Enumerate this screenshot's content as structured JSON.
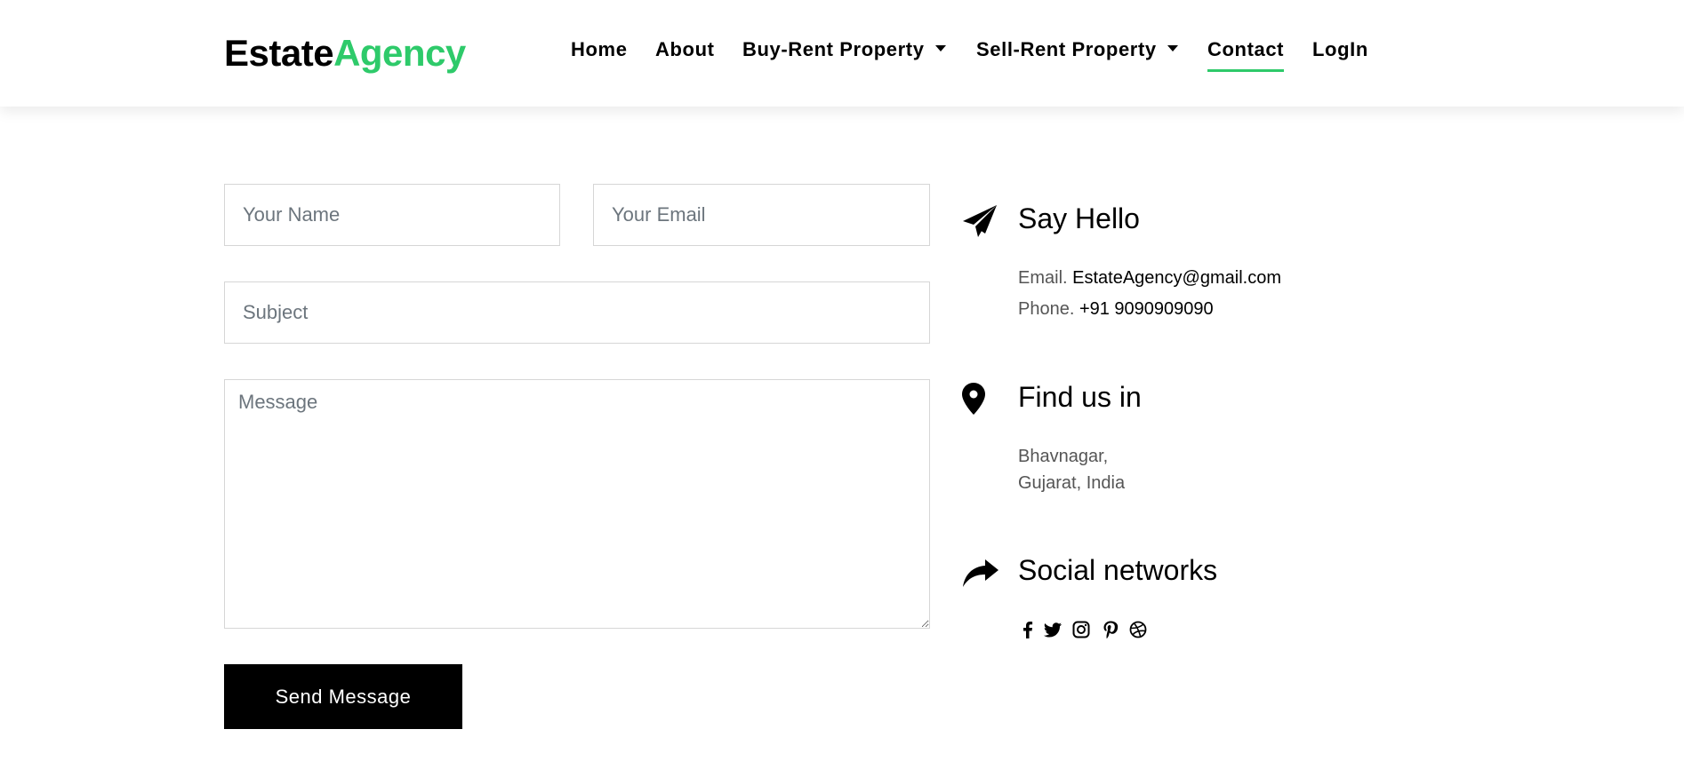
{
  "brand": {
    "part1": "Estate",
    "part2": "Agency"
  },
  "nav": {
    "home": "Home",
    "about": "About",
    "buy_rent": "Buy-Rent Property",
    "sell_rent": "Sell-Rent Property",
    "contact": "Contact",
    "login": "LogIn"
  },
  "form": {
    "name_placeholder": "Your Name",
    "email_placeholder": "Your Email",
    "subject_placeholder": "Subject",
    "message_placeholder": "Message",
    "send_label": "Send Message"
  },
  "say_hello": {
    "title": "Say Hello",
    "email_label": "Email.",
    "email_value": "EstateAgency@gmail.com",
    "phone_label": "Phone.",
    "phone_value": "+91 9090909090"
  },
  "find_us": {
    "title": "Find us in",
    "line1": "Bhavnagar,",
    "line2": "Gujarat, India"
  },
  "social": {
    "title": "Social networks",
    "icons": [
      "facebook-icon",
      "twitter-icon",
      "instagram-icon",
      "pinterest-icon",
      "dribbble-icon"
    ]
  },
  "colors": {
    "accent": "#2eca6a",
    "button": "#000000"
  }
}
